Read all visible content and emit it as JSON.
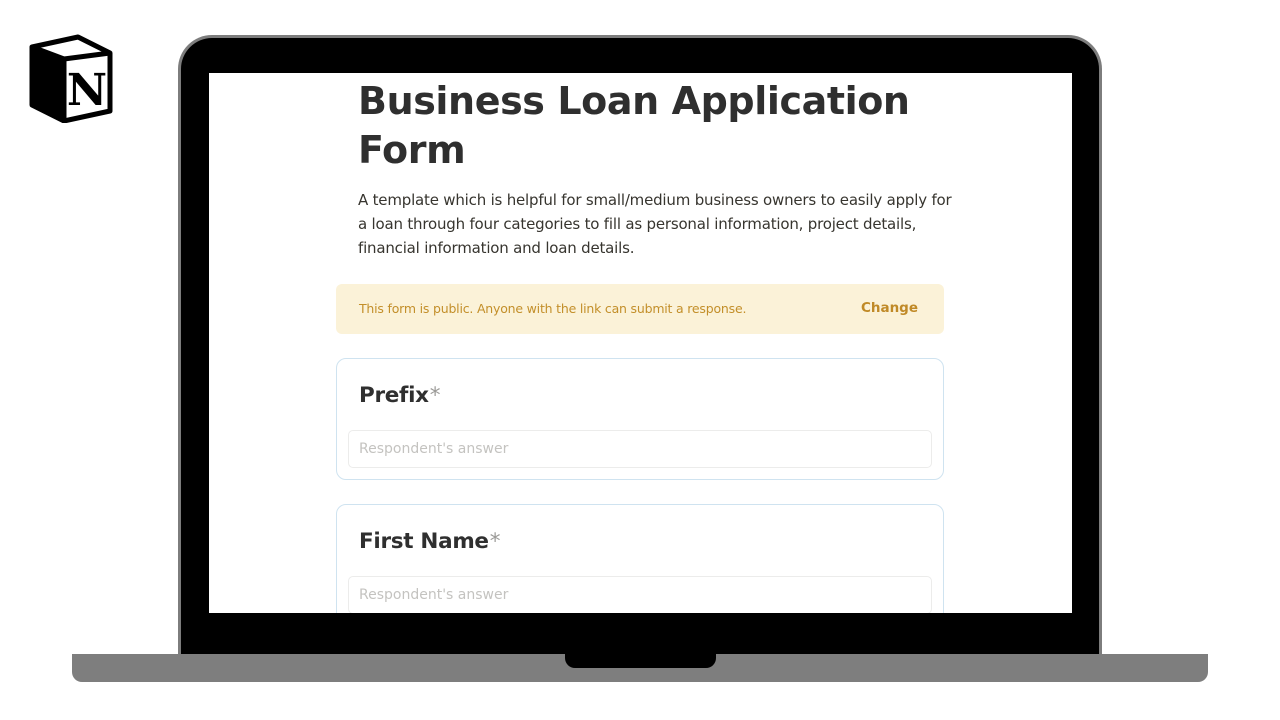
{
  "brand": {
    "logo_letter": "N"
  },
  "form": {
    "title": "Business Loan Application Form",
    "description": "A template which is helpful for small/medium business owners to easily apply for a loan through four categories to fill as personal information, project details, financial information and loan details.",
    "notice": {
      "text": "This form is public. Anyone with the link can submit a response.",
      "action_label": "Change"
    },
    "questions": [
      {
        "label": "Prefix",
        "required_mark": "*",
        "placeholder": "Respondent's answer",
        "value": ""
      },
      {
        "label": "First Name",
        "required_mark": "*",
        "placeholder": "Respondent's answer",
        "value": ""
      }
    ]
  },
  "colors": {
    "notice_bg": "#fbf2d8",
    "notice_text": "#c38f2a",
    "card_border": "#cfe3f0",
    "laptop_frame": "#7d7d7d"
  }
}
